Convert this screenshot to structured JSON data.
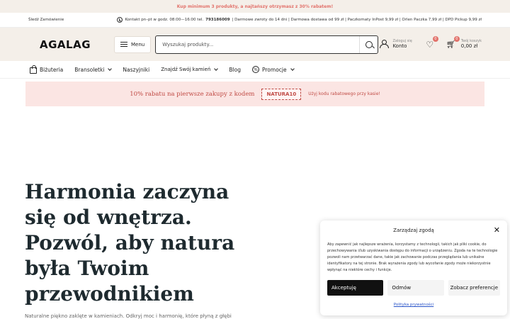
{
  "promo_bar": {
    "text": "Kup minimum 3 produkty, a najtańszy otrzymasz z 30% rabatem!"
  },
  "info_bar": {
    "track_order": "Śledź Zamówienie",
    "contact_prefix": "Kontakt pn–pt w godz. 08:00—16:00 tel.",
    "phone": "793186009",
    "details": "| Darmowe zwroty do 14 dni | Darmowa dostawa od 99 zł | Paczkomaty InPost 9,99 zł | Orlen Paczka 7,99 zł | DPD Pickup 9,99 zł"
  },
  "header": {
    "logo": "AGALAG",
    "menu_label": "Menu",
    "search_placeholder": "Wyszukaj produkty...",
    "account_small": "Zaloguj się",
    "account_big": "Konto",
    "wishlist_count": "0",
    "cart_count": "0",
    "cart_small": "Twój koszyk",
    "cart_total": "0,00 zł"
  },
  "nav": {
    "items": [
      {
        "label": "Biżuteria",
        "icon": "bag-icon",
        "dropdown": false
      },
      {
        "label": "Bransoletki",
        "dropdown": true
      },
      {
        "label": "Naszyjniki",
        "dropdown": false
      },
      {
        "label": "Znajdź Swój kamień",
        "dropdown": true
      },
      {
        "label": "Blog",
        "dropdown": false
      },
      {
        "label": "Promocje",
        "icon": "percent-icon",
        "dropdown": true
      }
    ]
  },
  "discount_banner": {
    "text": "10% rabatu na pierwsze zakupy z kodem",
    "code": "NATURA10",
    "note": "Użyj kodu rabatowego przy kasie!"
  },
  "hero": {
    "title": "Harmonia zaczyna się od wnętrza. Pozwól, aby natura była Twoim przewodnikiem",
    "subtitle": "Naturalne piękno zaklęte w kamieniach. Odkryj moc i harmonię, które płyną z głębi"
  },
  "cookie_modal": {
    "title": "Zarządzaj zgodą",
    "body": "Aby zapewnić jak najlepsze wrażenia, korzystamy z technologii, takich jak pliki cookie, do przechowywania i/lub uzyskiwania dostępu do informacji o urządzeniu. Zgoda na te technologie pozwoli nam przetwarzać dane, takie jak zachowanie podczas przeglądania lub unikalne identyfikatory na tej stronie. Brak wyrażenia zgody lub wycofanie zgody może niekorzystnie wpłynąć na niektóre cechy i funkcje.",
    "accept_label": "Akceptuję",
    "deny_label": "Odmów",
    "prefs_label": "Zobacz preferencje",
    "policy_link": "Polityka prywatności"
  },
  "colors": {
    "accent": "#e2726b",
    "header_bg": "#f4efe9",
    "banner_bg": "#fbe5e3",
    "hero_text": "#1e2a2f"
  }
}
